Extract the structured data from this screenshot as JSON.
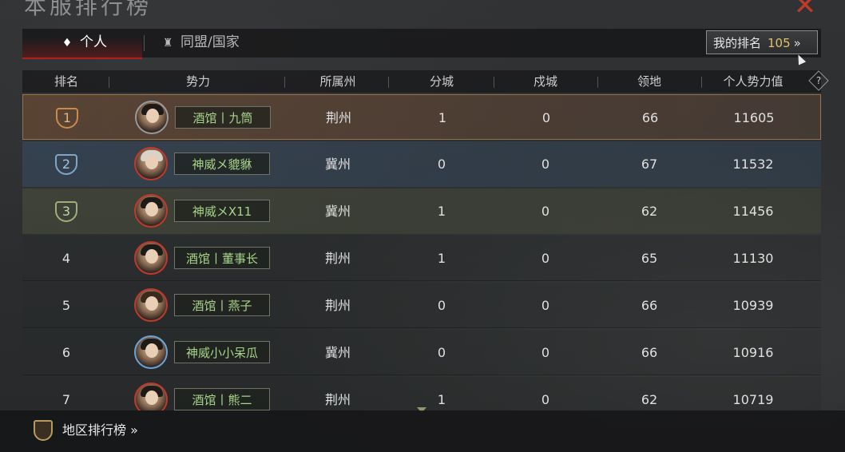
{
  "window": {
    "title": "本服排行榜",
    "close_glyph": "✕"
  },
  "tabs": [
    {
      "label": "个人",
      "icon": "person-crest-icon",
      "active": true
    },
    {
      "label": "同盟/国家",
      "icon": "alliance-crest-icon",
      "active": false
    }
  ],
  "my_rank": {
    "label": "我的排名",
    "value": "105",
    "chevron": "»"
  },
  "columns": [
    "排名",
    "势力",
    "所属州",
    "分城",
    "戍城",
    "领地",
    "个人势力值"
  ],
  "help_glyph": "?",
  "rows": [
    {
      "rank": "1",
      "name": "酒馆丨九筒",
      "state": "荆州",
      "branch": "1",
      "garrison": "0",
      "territory": "66",
      "power": "11605"
    },
    {
      "rank": "2",
      "name": "神威メ貔貅",
      "state": "冀州",
      "branch": "0",
      "garrison": "0",
      "territory": "67",
      "power": "11532"
    },
    {
      "rank": "3",
      "name": "神威メX11",
      "state": "冀州",
      "branch": "1",
      "garrison": "0",
      "territory": "62",
      "power": "11456"
    },
    {
      "rank": "4",
      "name": "酒馆丨董事长",
      "state": "荆州",
      "branch": "1",
      "garrison": "0",
      "territory": "65",
      "power": "11130"
    },
    {
      "rank": "5",
      "name": "酒馆丨燕子",
      "state": "荆州",
      "branch": "0",
      "garrison": "0",
      "territory": "66",
      "power": "10939"
    },
    {
      "rank": "6",
      "name": "神威小小呆瓜",
      "state": "冀州",
      "branch": "0",
      "garrison": "0",
      "territory": "66",
      "power": "10916"
    },
    {
      "rank": "7",
      "name": "酒馆丨熊二",
      "state": "荆州",
      "branch": "1",
      "garrison": "0",
      "territory": "62",
      "power": "10719"
    }
  ],
  "footer": {
    "label": "地区排行榜 »",
    "icon": "region-emblem-icon"
  },
  "colors": {
    "accent_red": "#b02020",
    "name_green": "#a8d48a",
    "rank_gold": "#e0c36a"
  }
}
